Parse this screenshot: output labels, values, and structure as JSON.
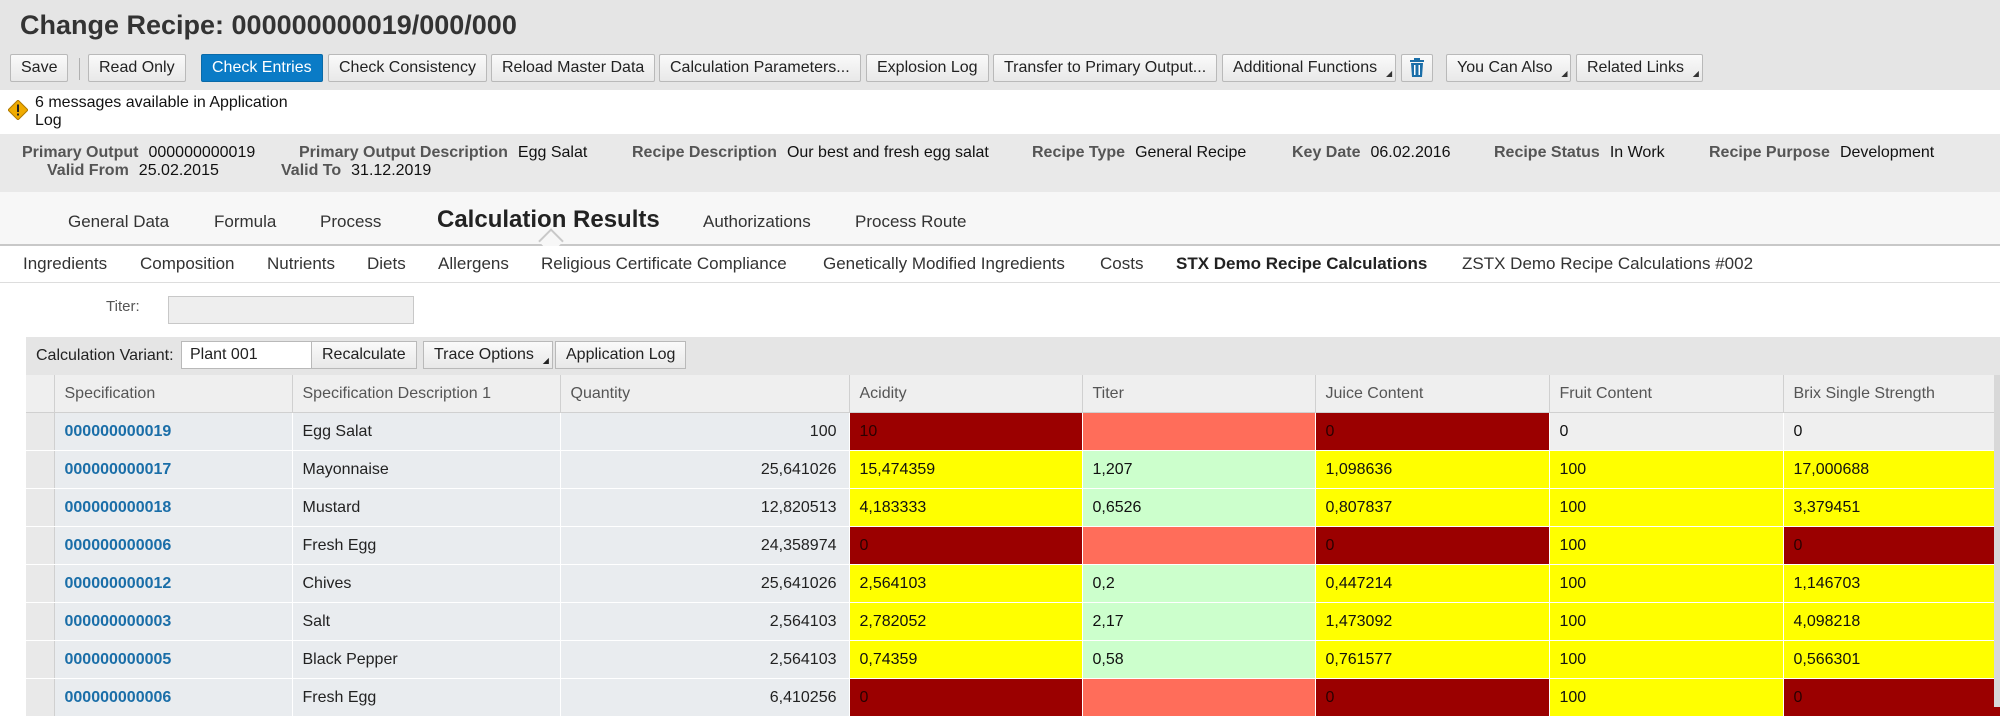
{
  "page": {
    "title": "Change Recipe: 000000000019/000/000"
  },
  "toolbar": {
    "save": "Save",
    "read_only": "Read Only",
    "check_entries": "Check Entries",
    "check_consistency": "Check Consistency",
    "reload_master_data": "Reload Master Data",
    "calculation_parameters": "Calculation Parameters...",
    "explosion_log": "Explosion Log",
    "transfer_primary_output": "Transfer to Primary Output...",
    "additional_functions": "Additional Functions",
    "you_can_also": "You Can Also",
    "related_links": "Related Links",
    "accent": "#0a7bc6"
  },
  "messages": {
    "text": "6 messages available in Application Log",
    "icon": "warning-icon"
  },
  "header": {
    "primary_output": {
      "label": "Primary Output",
      "value": "000000000019"
    },
    "valid_from": {
      "label": "Valid From",
      "value": "25.02.2015"
    },
    "primary_output_description": {
      "label": "Primary Output Description",
      "value": "Egg Salat"
    },
    "valid_to": {
      "label": "Valid To",
      "value": "31.12.2019"
    },
    "recipe_description": {
      "label": "Recipe Description",
      "value": "Our best and fresh egg salat"
    },
    "recipe_type": {
      "label": "Recipe Type",
      "value": "General Recipe"
    },
    "key_date": {
      "label": "Key Date",
      "value": "06.02.2016"
    },
    "recipe_status": {
      "label": "Recipe Status",
      "value": "In Work"
    },
    "recipe_purpose": {
      "label": "Recipe Purpose",
      "value": "Development"
    }
  },
  "tabs": [
    "General Data",
    "Formula",
    "Process",
    "Calculation Results",
    "Authorizations",
    "Process Route"
  ],
  "active_tab": "Calculation Results",
  "subtabs": [
    "Ingredients",
    "Composition",
    "Nutrients",
    "Diets",
    "Allergens",
    "Religious Certificate Compliance",
    "Genetically Modified Ingredients",
    "Costs",
    "STX Demo Recipe Calculations",
    "ZSTX Demo Recipe Calculations #002"
  ],
  "active_subtab": "STX Demo Recipe Calculations",
  "titer_field": {
    "label": "Titer:",
    "value": ""
  },
  "calc_toolbar": {
    "variant_label": "Calculation Variant:",
    "variant_value": "Plant 001",
    "recalculate": "Recalculate",
    "trace_options": "Trace Options",
    "application_log": "Application Log"
  },
  "table": {
    "columns": [
      "Specification",
      "Specification Description 1",
      "Quantity",
      "Acidity",
      "Titer",
      "Juice Content",
      "Fruit Content",
      "Brix Single Strength"
    ],
    "rows": [
      {
        "spec": "000000000019",
        "desc": "Egg Salat",
        "qty": "100",
        "acidity": "10",
        "titer": "",
        "juice": "0",
        "fruit": "0",
        "brix": "0"
      },
      {
        "spec": "000000000017",
        "desc": "Mayonnaise",
        "qty": "25,641026",
        "acidity": "15,474359",
        "titer": "1,207",
        "juice": "1,098636",
        "fruit": "100",
        "brix": "17,000688"
      },
      {
        "spec": "000000000018",
        "desc": "Mustard",
        "qty": "12,820513",
        "acidity": "4,183333",
        "titer": "0,6526",
        "juice": "0,807837",
        "fruit": "100",
        "brix": "3,379451"
      },
      {
        "spec": "000000000006",
        "desc": "Fresh Egg",
        "qty": "24,358974",
        "acidity": "0",
        "titer": "",
        "juice": "0",
        "fruit": "100",
        "brix": "0"
      },
      {
        "spec": "000000000012",
        "desc": "Chives",
        "qty": "25,641026",
        "acidity": "2,564103",
        "titer": "0,2",
        "juice": "0,447214",
        "fruit": "100",
        "brix": "1,146703"
      },
      {
        "spec": "000000000003",
        "desc": "Salt",
        "qty": "2,564103",
        "acidity": "2,782052",
        "titer": "2,17",
        "juice": "1,473092",
        "fruit": "100",
        "brix": "4,098218"
      },
      {
        "spec": "000000000005",
        "desc": "Black Pepper",
        "qty": "2,564103",
        "acidity": "0,74359",
        "titer": "0,58",
        "juice": "0,761577",
        "fruit": "100",
        "brix": "0,566301"
      },
      {
        "spec": "000000000006",
        "desc": "Fresh Egg",
        "qty": "6,410256",
        "acidity": "0",
        "titer": "",
        "juice": "0",
        "fruit": "100",
        "brix": "0"
      }
    ],
    "status_colors": {
      "dark_red": "#9b0000",
      "light_red": "#ff6d5a",
      "yellow": "#ffff00",
      "green": "#ccffcc",
      "link": "#1a6ea8"
    }
  }
}
